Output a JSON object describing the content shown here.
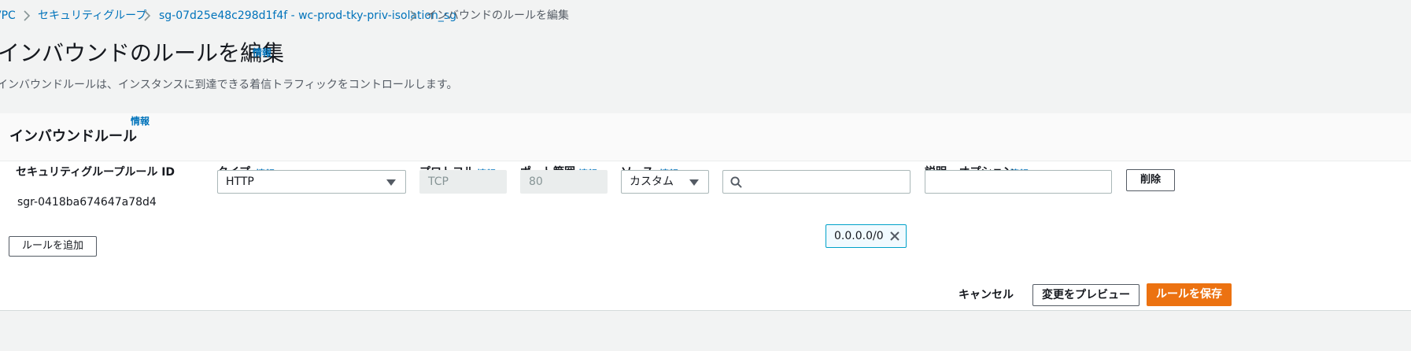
{
  "breadcrumb": {
    "items": [
      {
        "label": "VPC"
      },
      {
        "label": "セキュリティグループ"
      },
      {
        "label": "sg-07d25e48c298d1f4f - wc-prod-tky-priv-isolation_sg"
      },
      {
        "label": "インバウンドのルールを編集"
      }
    ]
  },
  "page": {
    "title": "インバウンドのルールを編集",
    "info_label": "情報",
    "description": "インバウンドルールは、インスタンスに到達できる着信トラフィックをコントロールします。"
  },
  "panel": {
    "title": "インバウンドルール",
    "info_label": "情報",
    "columns": [
      {
        "label": "セキュリティグループルール ID",
        "info": ""
      },
      {
        "label": "タイプ",
        "info": "情報"
      },
      {
        "label": "プロトコル",
        "info": "情報"
      },
      {
        "label": "ポート範囲",
        "info": "情報"
      },
      {
        "label": "ソース",
        "info": "情報"
      },
      {
        "label": "説明 - オプション",
        "info": "情報"
      }
    ],
    "rule": {
      "id": "sgr-0418ba674647a78d4",
      "type": "HTTP",
      "protocol": "TCP",
      "port_range": "80",
      "source_type": "カスタム",
      "source_search_value": "",
      "source_token": "0.0.0.0/0",
      "description_value": "",
      "delete_label": "削除"
    },
    "add_rule_label": "ルールを追加"
  },
  "footer": {
    "cancel_label": "キャンセル",
    "preview_label": "変更をプレビュー",
    "save_label": "ルールを保存"
  },
  "colors": {
    "link": "#0073bb",
    "primary": "#ec7211",
    "token_border": "#00a1c9"
  },
  "icons": [
    "chevron-right-icon",
    "caret-down-icon",
    "search-icon",
    "close-icon"
  ]
}
